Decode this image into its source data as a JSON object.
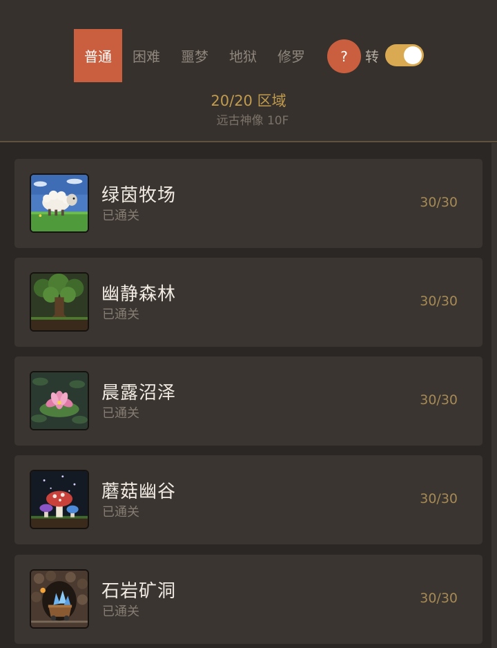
{
  "difficulty_tabs": [
    {
      "label": "普通",
      "active": true
    },
    {
      "label": "困难",
      "active": false
    },
    {
      "label": "噩梦",
      "active": false
    },
    {
      "label": "地狱",
      "active": false
    },
    {
      "label": "修罗",
      "active": false
    }
  ],
  "help_button": {
    "label": "?",
    "icon": "question-icon"
  },
  "toggle": {
    "label": "转",
    "on": true
  },
  "progress_text": "20/20 区域",
  "subtitle_text": "远古神像 10F",
  "colors": {
    "accent": "#c95f3f",
    "toggle_on": "#d9aa52",
    "progress": "#c29c4e",
    "count": "#a68a55"
  },
  "regions": [
    {
      "name": "绿茵牧场",
      "status": "已通关",
      "count": "30/30",
      "icon": "sheep-pasture-icon"
    },
    {
      "name": "幽静森林",
      "status": "已通关",
      "count": "30/30",
      "icon": "forest-tree-icon"
    },
    {
      "name": "晨露沼泽",
      "status": "已通关",
      "count": "30/30",
      "icon": "lotus-swamp-icon"
    },
    {
      "name": "蘑菇幽谷",
      "status": "已通关",
      "count": "30/30",
      "icon": "mushroom-valley-icon"
    },
    {
      "name": "石岩矿洞",
      "status": "已通关",
      "count": "30/30",
      "icon": "crystal-minecart-icon"
    }
  ]
}
